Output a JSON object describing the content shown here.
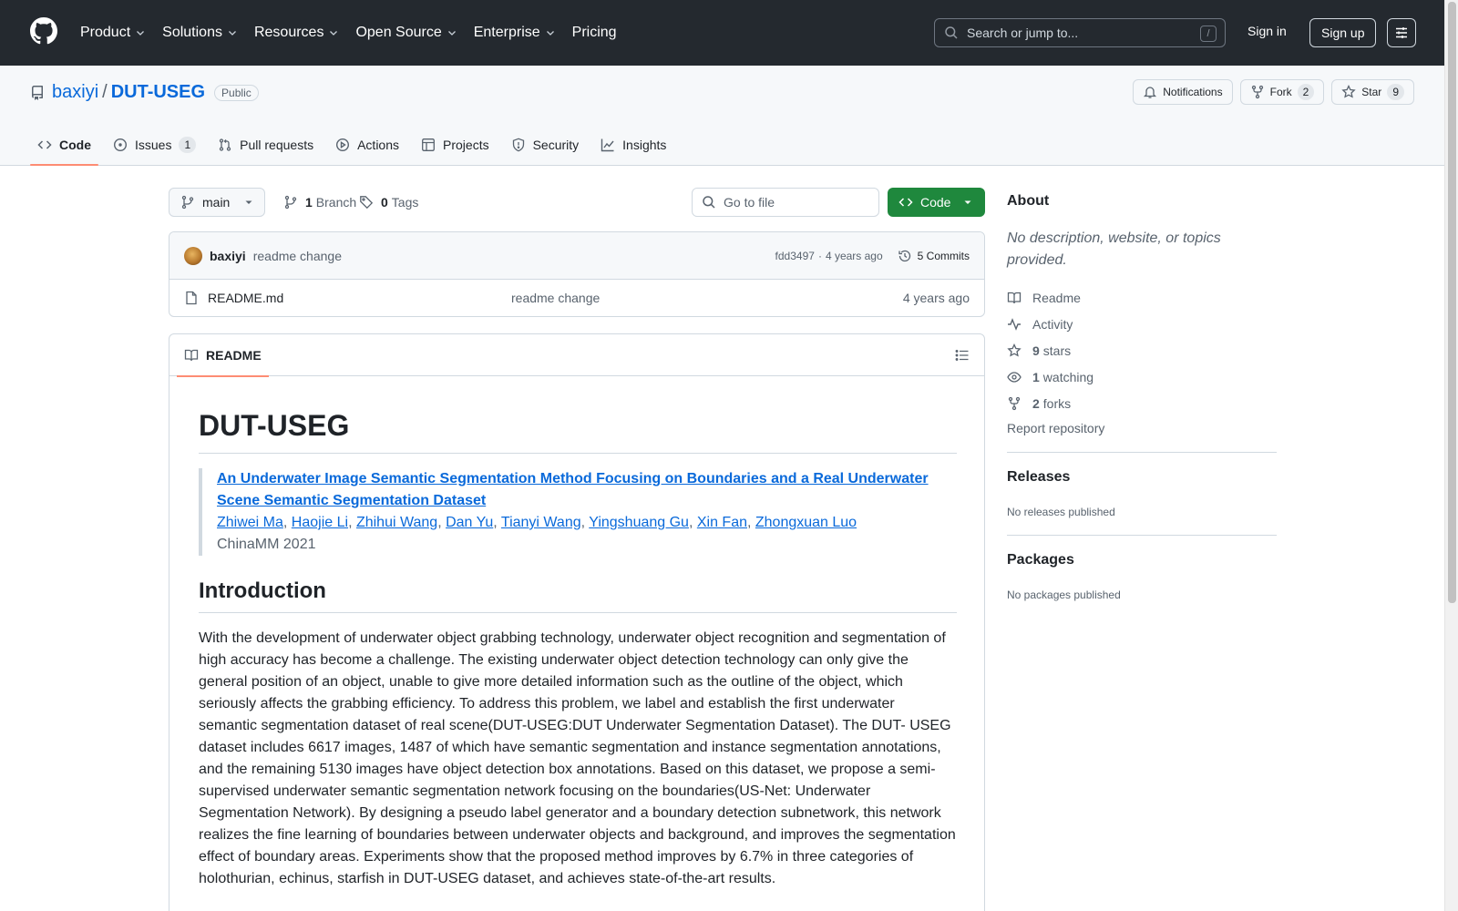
{
  "header": {
    "nav": [
      {
        "label": "Product",
        "dropdown": true
      },
      {
        "label": "Solutions",
        "dropdown": true
      },
      {
        "label": "Resources",
        "dropdown": true
      },
      {
        "label": "Open Source",
        "dropdown": true
      },
      {
        "label": "Enterprise",
        "dropdown": true
      },
      {
        "label": "Pricing",
        "dropdown": false
      }
    ],
    "search_placeholder": "Search or jump to...",
    "search_shortcut": "/",
    "sign_in": "Sign in",
    "sign_up": "Sign up"
  },
  "repo": {
    "owner": "baxiyi",
    "separator": "/",
    "name": "DUT-USEG",
    "visibility": "Public",
    "notifications_label": "Notifications",
    "fork_label": "Fork",
    "fork_count": "2",
    "star_label": "Star",
    "star_count": "9"
  },
  "tabs": [
    {
      "label": "Code",
      "count": "",
      "active": true,
      "icon": "code-icon"
    },
    {
      "label": "Issues",
      "count": "1",
      "active": false,
      "icon": "issue-icon"
    },
    {
      "label": "Pull requests",
      "count": "",
      "active": false,
      "icon": "pull-request-icon"
    },
    {
      "label": "Actions",
      "count": "",
      "active": false,
      "icon": "play-icon"
    },
    {
      "label": "Projects",
      "count": "",
      "active": false,
      "icon": "table-icon"
    },
    {
      "label": "Security",
      "count": "",
      "active": false,
      "icon": "shield-icon"
    },
    {
      "label": "Insights",
      "count": "",
      "active": false,
      "icon": "graph-icon"
    }
  ],
  "toolbar": {
    "branch": "main",
    "branch_count": "1",
    "branch_label": "Branch",
    "tag_count": "0",
    "tag_label": "Tags",
    "goto_placeholder": "Go to file",
    "code_label": "Code"
  },
  "latest_commit": {
    "user": "baxiyi",
    "message": "readme change",
    "hash": "fdd3497",
    "age_sep": "·",
    "age": "4 years ago",
    "commits": "5 Commits"
  },
  "files": [
    {
      "name": "README.md",
      "message": "readme change",
      "age": "4 years ago"
    }
  ],
  "readme": {
    "tab_label": "README",
    "title": "DUT-USEG",
    "paper_title": "An Underwater Image Semantic Segmentation Method Focusing on Boundaries and a Real Underwater Scene Semantic Segmentation Dataset",
    "authors": [
      "Zhiwei Ma",
      "Haojie Li",
      "Zhihui Wang",
      "Dan Yu",
      "Tianyi Wang",
      "Yingshuang Gu",
      "Xin Fan",
      "Zhongxuan Luo"
    ],
    "venue": "ChinaMM 2021",
    "intro_heading": "Introduction",
    "intro_text": "With the development of underwater object grabbing technology, underwater object recognition and segmentation of high accuracy has become a challenge. The existing underwater object detection technology can only give the general position of an object, unable to give more detailed information such as the outline of the object, which seriously affects the grabbing efficiency. To address this problem, we label and establish the first underwater semantic segmentation dataset of real scene(DUT-USEG:DUT Underwater Segmentation Dataset). The DUT- USEG dataset includes 6617 images, 1487 of which have semantic segmentation and instance segmentation annotations, and the remaining 5130 images have object detection box annotations. Based on this dataset, we propose a semi-supervised underwater semantic segmentation network focusing on the boundaries(US-Net: Underwater Segmentation Network). By designing a pseudo label generator and a boundary detection subnetwork, this network realizes the fine learning of boundaries between underwater objects and background, and improves the segmentation effect of boundary areas. Experiments show that the proposed method improves by 6.7% in three categories of holothurian, echinus, starfish in DUT-USEG dataset, and achieves state-of-the-art results."
  },
  "sidebar": {
    "about_heading": "About",
    "about_desc": "No description, website, or topics provided.",
    "readme_link": "Readme",
    "activity_link": "Activity",
    "stars_count": "9",
    "stars_label": "stars",
    "watching_count": "1",
    "watching_label": "watching",
    "forks_count": "2",
    "forks_label": "forks",
    "report": "Report repository",
    "releases_heading": "Releases",
    "releases_note": "No releases published",
    "packages_heading": "Packages",
    "packages_note": "No packages published"
  },
  "colors": {
    "header_bg": "#24292f",
    "link": "#0969da",
    "primary_button": "#1f883d",
    "active_tab_underline": "#fd8c73"
  }
}
